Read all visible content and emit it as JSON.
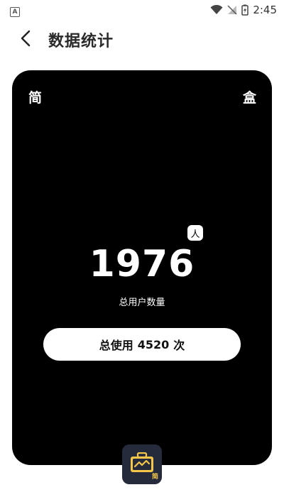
{
  "status_bar": {
    "time": "2:45",
    "app_icon_letter": "A",
    "icons": [
      "wifi-icon",
      "no-signal-icon",
      "battery-charging-icon"
    ]
  },
  "app_bar": {
    "title": "数据统计",
    "back_icon": "chevron-left-icon"
  },
  "card": {
    "corner_left": "简",
    "corner_right": "盒",
    "unit": "人",
    "user_count": "1976",
    "user_count_label": "总用户数量",
    "usage": {
      "prefix": "总使用",
      "count": "4520",
      "suffix": "次"
    }
  },
  "bottom_logo": {
    "icon": "toolbox-logo-icon",
    "char": "简"
  },
  "colors": {
    "card_bg": "#000000",
    "logo_bg": "#262b3b",
    "logo_accent": "#f4c74a"
  }
}
